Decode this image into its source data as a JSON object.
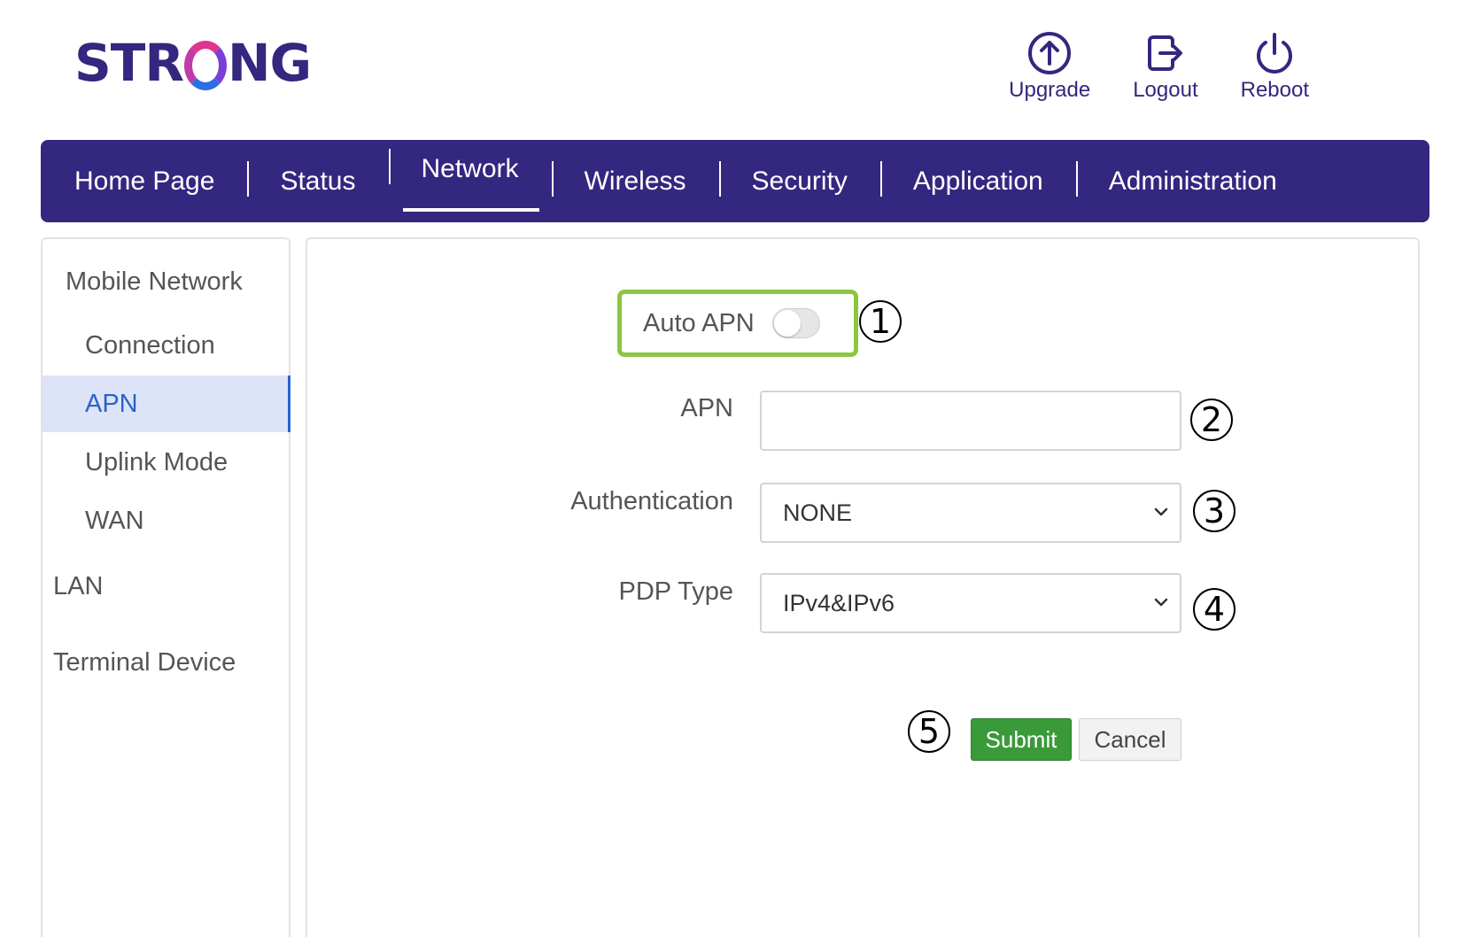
{
  "brand": {
    "logo_prefix": "STR",
    "logo_suffix": "NG"
  },
  "top_actions": [
    {
      "label": "Upgrade",
      "icon": "upload-circle-icon"
    },
    {
      "label": "Logout",
      "icon": "logout-icon"
    },
    {
      "label": "Reboot",
      "icon": "power-icon"
    }
  ],
  "nav": {
    "items": [
      "Home Page",
      "Status",
      "Network",
      "Wireless",
      "Security",
      "Application",
      "Administration"
    ],
    "active": "Network"
  },
  "sidebar": {
    "items": [
      "Mobile Network",
      "Connection",
      "APN",
      "Uplink Mode",
      "WAN",
      "LAN",
      "Terminal Device"
    ],
    "active": "APN"
  },
  "form": {
    "auto_apn_label": "Auto APN",
    "auto_apn_enabled": false,
    "apn_label": "APN",
    "apn_value": "",
    "auth_label": "Authentication",
    "auth_value": "NONE",
    "pdp_label": "PDP Type",
    "pdp_value": "IPv4&IPv6",
    "submit_label": "Submit",
    "cancel_label": "Cancel"
  },
  "callouts": [
    "1",
    "2",
    "3",
    "4",
    "5"
  ],
  "colors": {
    "brand_purple": "#33277f",
    "highlight_green": "#8cc63f",
    "submit_green": "#3a9a3a",
    "active_blue": "#2b63c9",
    "active_bg": "#dde4f7"
  }
}
